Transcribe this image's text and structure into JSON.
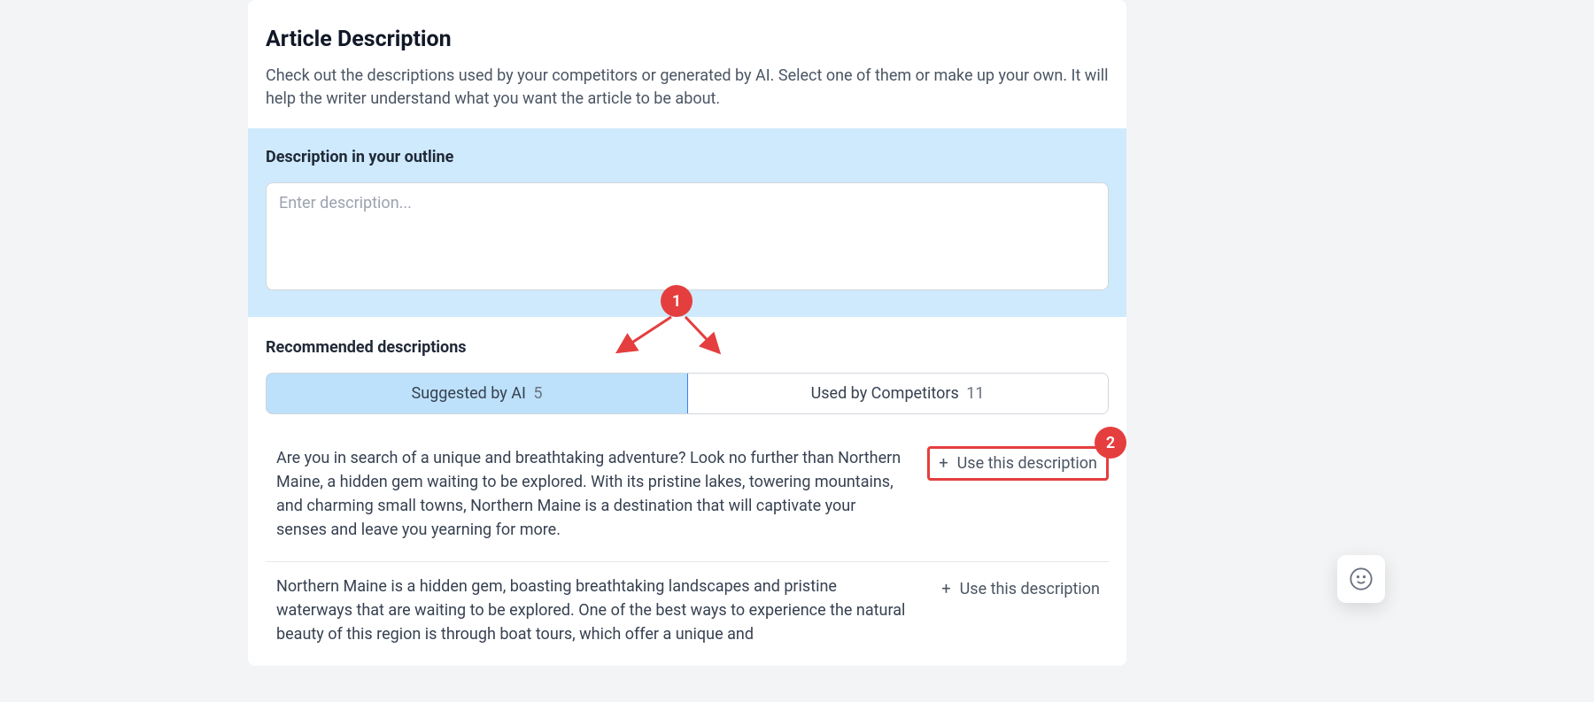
{
  "header": {
    "title": "Article Description",
    "subtitle": "Check out the descriptions used by your competitors or generated by AI. Select one of them or make up your own. It will help the writer understand what you want the article to be about."
  },
  "outline": {
    "label": "Description in your outline",
    "placeholder": "Enter description...",
    "value": ""
  },
  "recommended": {
    "label": "Recommended descriptions",
    "tabs": {
      "ai": {
        "label": "Suggested by AI",
        "count": "5"
      },
      "competitors": {
        "label": "Used by Competitors",
        "count": "11"
      }
    },
    "items": [
      {
        "text": "Are you in search of a unique and breathtaking adventure? Look no further than Northern Maine, a hidden gem waiting to be explored. With its pristine lakes, towering mountains, and charming small towns, Northern Maine is a destination that will captivate your senses and leave you yearning for more.",
        "button": "Use this description"
      },
      {
        "text": "Northern Maine is a hidden gem, boasting breathtaking landscapes and pristine waterways that are waiting to be explored. One of the best ways to experience the natural beauty of this region is through boat tours, which offer a unique and",
        "button": "Use this description"
      }
    ]
  },
  "annotations": {
    "badge1": "1",
    "badge2": "2"
  }
}
